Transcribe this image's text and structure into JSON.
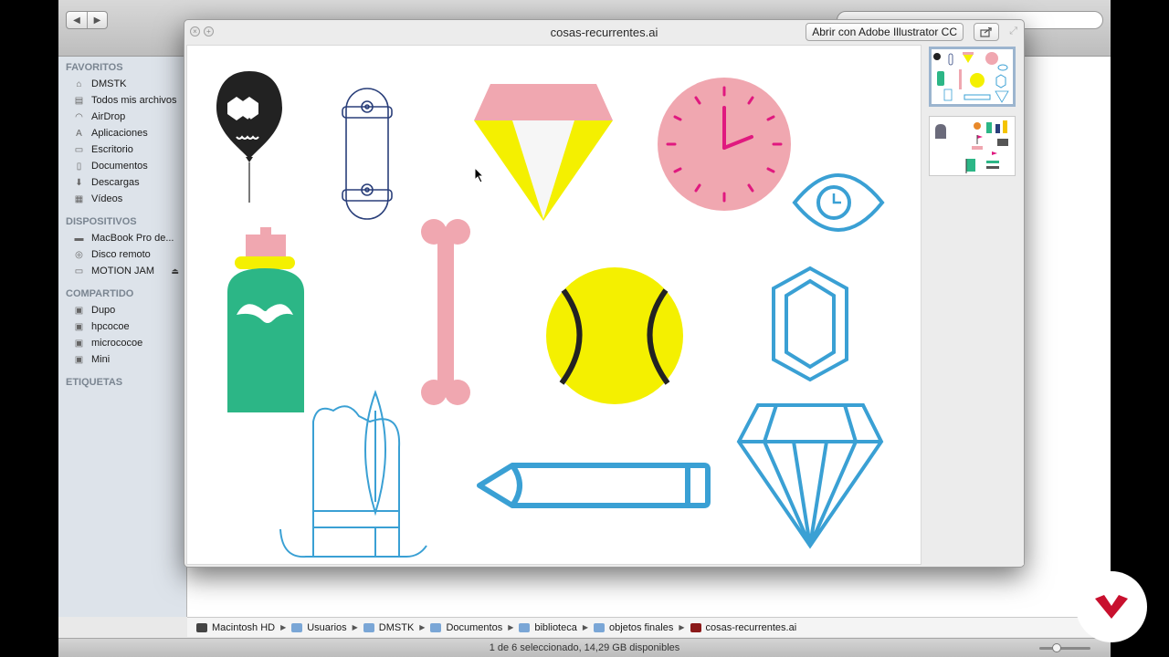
{
  "finder": {
    "sidebar": {
      "sections": [
        {
          "title": "FAVORITOS",
          "items": [
            {
              "label": "DMSTK",
              "icon": "home-icon"
            },
            {
              "label": "Todos mis archivos",
              "icon": "all-files-icon"
            },
            {
              "label": "AirDrop",
              "icon": "airdrop-icon"
            },
            {
              "label": "Aplicaciones",
              "icon": "applications-icon"
            },
            {
              "label": "Escritorio",
              "icon": "desktop-icon"
            },
            {
              "label": "Documentos",
              "icon": "documents-icon"
            },
            {
              "label": "Descargas",
              "icon": "downloads-icon"
            },
            {
              "label": "Vídeos",
              "icon": "movies-icon"
            }
          ]
        },
        {
          "title": "DISPOSITIVOS",
          "items": [
            {
              "label": "MacBook Pro de...",
              "icon": "laptop-icon"
            },
            {
              "label": "Disco remoto",
              "icon": "remote-disc-icon"
            },
            {
              "label": "MOTION JAM",
              "icon": "drive-icon",
              "eject": true
            }
          ]
        },
        {
          "title": "COMPARTIDO",
          "items": [
            {
              "label": "Dupo",
              "icon": "network-computer-icon"
            },
            {
              "label": "hpcocoe",
              "icon": "network-computer-icon"
            },
            {
              "label": "micrococoe",
              "icon": "network-computer-icon"
            },
            {
              "label": "Mini",
              "icon": "network-computer-icon"
            }
          ]
        },
        {
          "title": "ETIQUETAS",
          "items": []
        }
      ]
    },
    "path_bar": [
      "Macintosh HD",
      "Usuarios",
      "DMSTK",
      "Documentos",
      "biblioteca",
      "objetos finales",
      "cosas-recurrentes.ai"
    ],
    "status": "1 de 6 seleccionado, 14,29 GB disponibles"
  },
  "quicklook": {
    "title": "cosas-recurrentes.ai",
    "open_button": "Abrir con Adobe Illustrator CC",
    "share_icon": "share-icon",
    "fullscreen_icon": "fullscreen-icon",
    "artboard_count": 2,
    "selected_artboard": 1
  },
  "colors": {
    "pink": "#f0a7b0",
    "magenta": "#e0197f",
    "yellow": "#f4f000",
    "blue": "#3aa0d4",
    "navy": "#2a3f7a",
    "green": "#2cb686",
    "black": "#222222"
  }
}
